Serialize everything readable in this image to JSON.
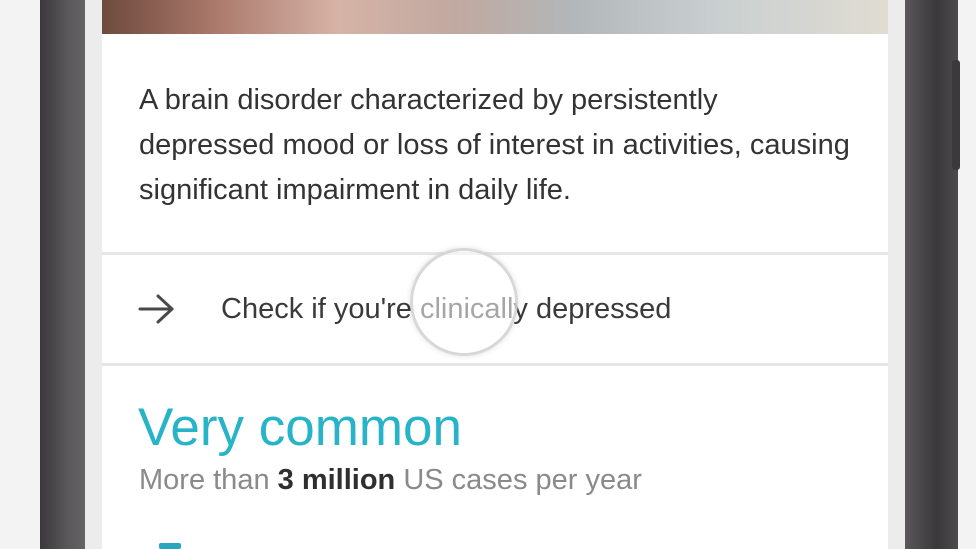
{
  "description": {
    "text": "A brain disorder characterized by persistently depressed mood or loss of interest in activities, causing significant impairment in daily life."
  },
  "link": {
    "icon": "arrow-right-icon",
    "label": "Check if you're clinically depressed"
  },
  "stats": {
    "headline": "Very common",
    "sub_prefix": "More than ",
    "sub_highlight": "3 million",
    "sub_suffix": " US cases per year"
  },
  "colors": {
    "accent": "#27b3c8",
    "text_primary": "#333333",
    "text_secondary": "#8a8a8a",
    "card_bg": "#ffffff",
    "phone_frame": "#4a474a"
  }
}
